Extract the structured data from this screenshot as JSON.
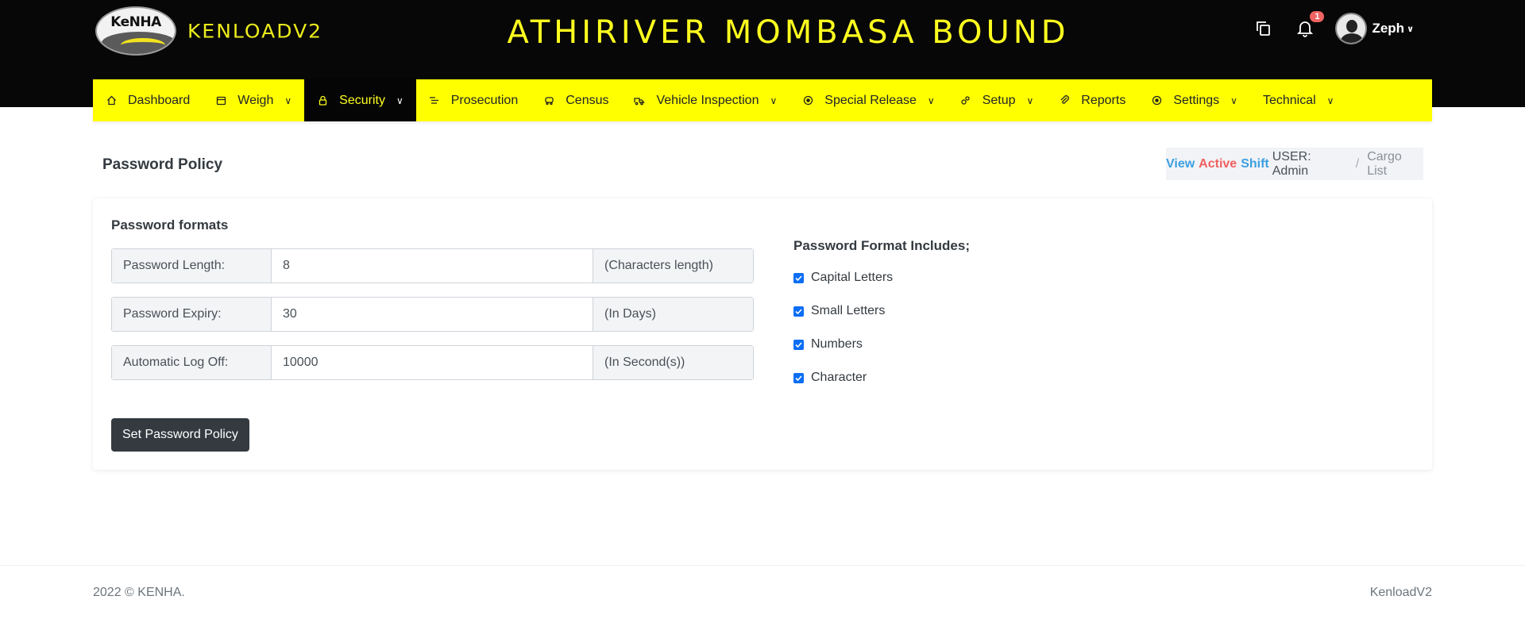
{
  "header": {
    "logo_text": "KeNHA",
    "app_name": "KENLOADV2",
    "station": "ATHIRIVER MOMBASA BOUND",
    "notification_count": "1",
    "user_name": "Zeph"
  },
  "nav": [
    {
      "label": "Dashboard",
      "icon": "home-icon",
      "dropdown": false
    },
    {
      "label": "Weigh",
      "icon": "calendar-icon",
      "dropdown": true
    },
    {
      "label": "Security",
      "icon": "lock-icon",
      "dropdown": true,
      "active": true
    },
    {
      "label": "Prosecution",
      "icon": "list-icon",
      "dropdown": false
    },
    {
      "label": "Census",
      "icon": "car-icon",
      "dropdown": false
    },
    {
      "label": "Vehicle Inspection",
      "icon": "truck-icon",
      "dropdown": true
    },
    {
      "label": "Special Release",
      "icon": "target-icon",
      "dropdown": true
    },
    {
      "label": "Setup",
      "icon": "gears-icon",
      "dropdown": true
    },
    {
      "label": "Reports",
      "icon": "paperclip-icon",
      "dropdown": false
    },
    {
      "label": "Settings",
      "icon": "target-icon",
      "dropdown": true
    },
    {
      "label": "Technical",
      "icon": "",
      "dropdown": true
    }
  ],
  "page": {
    "title": "Password Policy",
    "breadcrumb": {
      "view": "View",
      "active": "Active",
      "shift": "Shift",
      "user": "USER: Admin",
      "current": "Cargo List"
    }
  },
  "form": {
    "section_title": "Password formats",
    "fields": [
      {
        "label": "Password Length:",
        "value": "8",
        "suffix": "(Characters length)"
      },
      {
        "label": "Password Expiry:",
        "value": "30",
        "suffix": "(In Days)"
      },
      {
        "label": "Automatic Log Off:",
        "value": "10000",
        "suffix": "(In Second(s))"
      }
    ],
    "submit_label": "Set Password Policy",
    "includes_title": "Password Format Includes;",
    "includes": [
      {
        "label": "Capital Letters",
        "checked": true
      },
      {
        "label": "Small Letters",
        "checked": true
      },
      {
        "label": "Numbers",
        "checked": true
      },
      {
        "label": "Character",
        "checked": true
      }
    ]
  },
  "footer": {
    "left": "2022 © KENHA.",
    "right": "KenloadV2"
  },
  "colors": {
    "nav_bg": "#ffff00",
    "header_bg": "#070707",
    "title_yellow": "#ffff1f",
    "checkbox_blue": "#0b6ef5"
  }
}
